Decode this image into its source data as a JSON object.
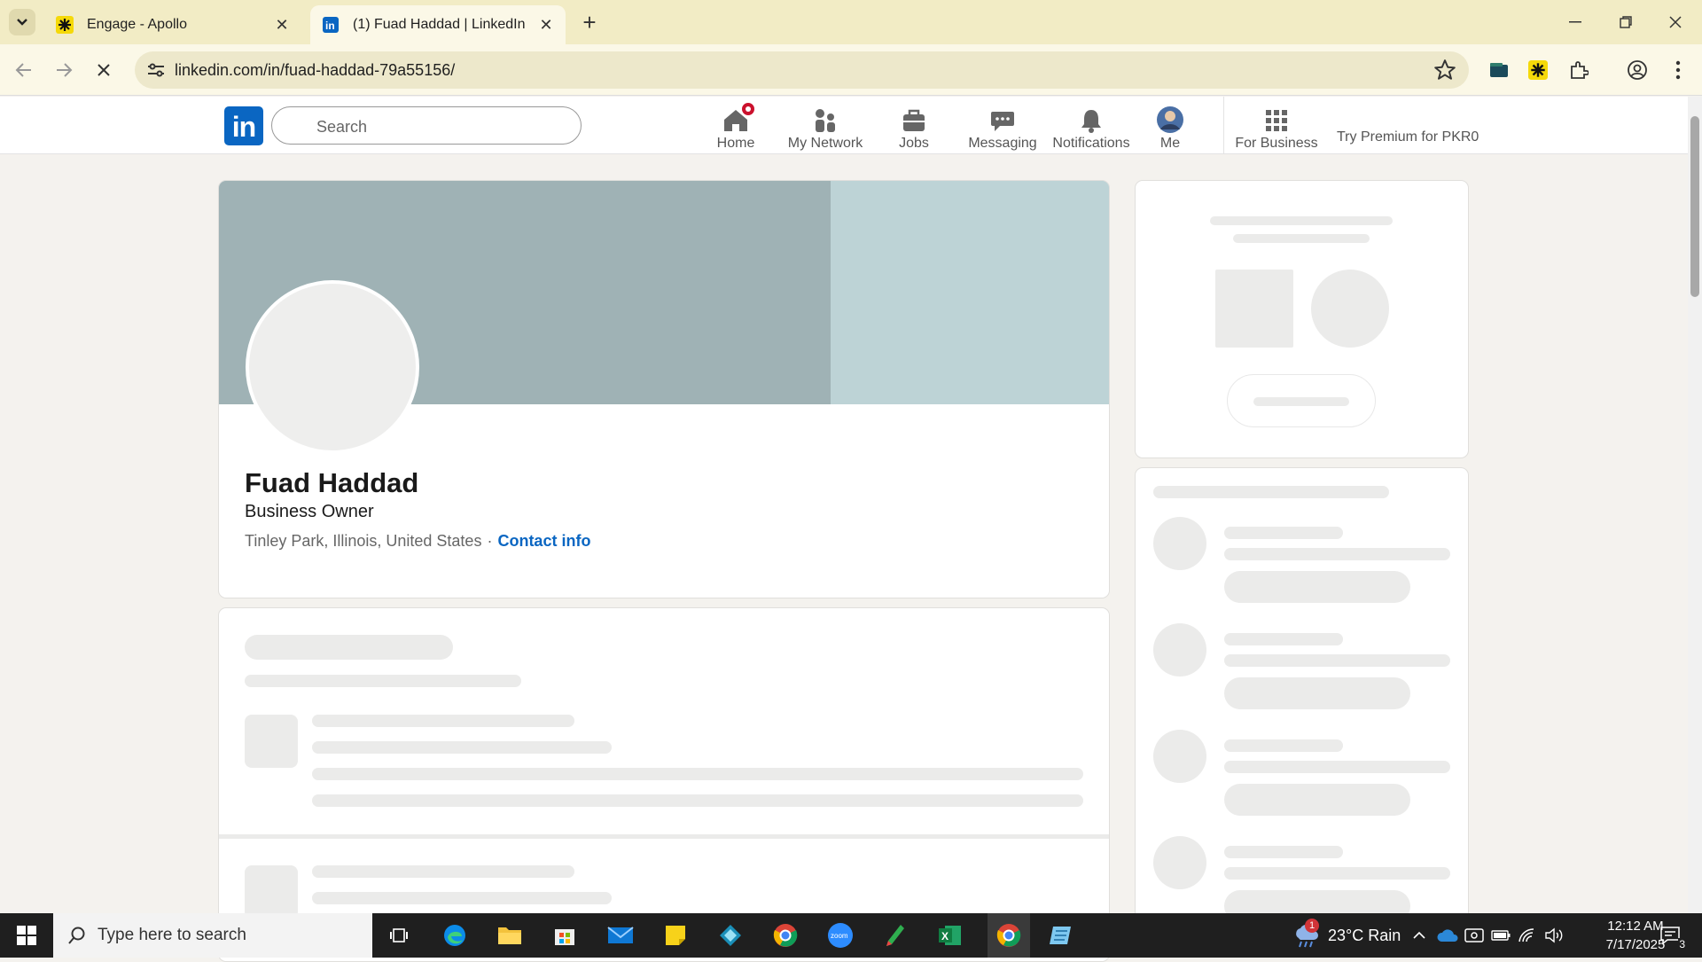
{
  "browser": {
    "tabs": [
      {
        "title": "Engage - Apollo",
        "active": false
      },
      {
        "title": "(1) Fuad Haddad | LinkedIn",
        "active": true
      }
    ],
    "url": "linkedin.com/in/fuad-haddad-79a55156/"
  },
  "linkedin": {
    "logo_text": "in",
    "search_placeholder": "Search",
    "nav": {
      "home": "Home",
      "network": "My Network",
      "jobs": "Jobs",
      "messaging": "Messaging",
      "notifications": "Notifications",
      "me": "Me",
      "business": "For Business",
      "premium": "Try Premium for PKR0"
    },
    "profile": {
      "name": "Fuad Haddad",
      "headline": "Business Owner",
      "location": "Tinley Park, Illinois, United States",
      "separator": "·",
      "contact_link": "Contact info"
    }
  },
  "taskbar": {
    "search_placeholder": "Type here to search",
    "weather": "23°C  Rain",
    "time": "12:12 AM",
    "date": "7/17/2025",
    "weather_badge": "1",
    "notification_count": "3"
  },
  "colors": {
    "linkedin_blue": "#0a66c2",
    "notification_red": "#cb112d",
    "browser_frame": "#f2ecc5"
  }
}
